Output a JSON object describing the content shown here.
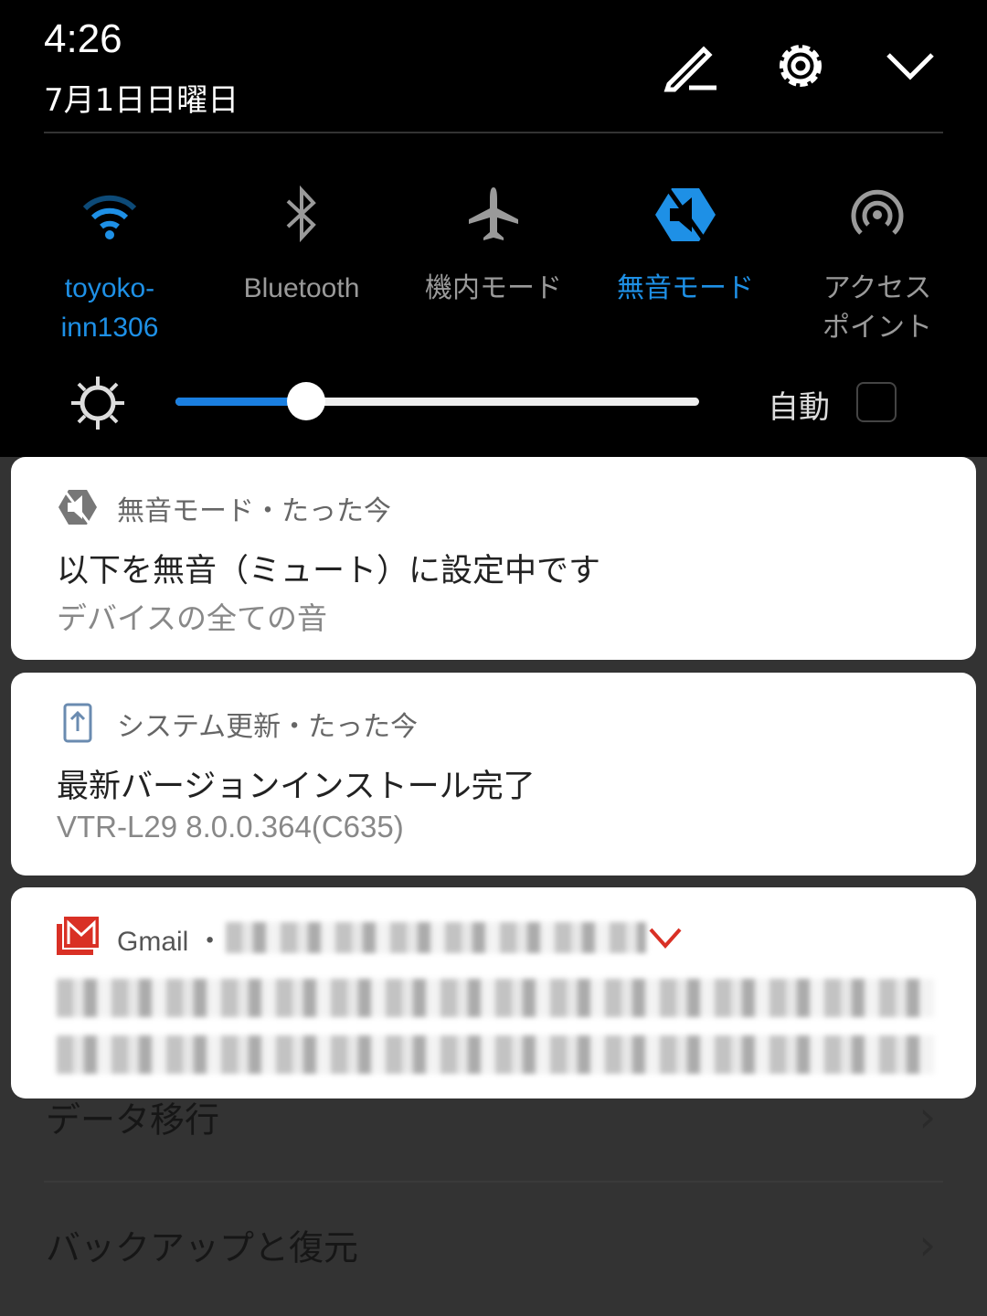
{
  "status": {
    "time": "4:26",
    "date": "7月1日日曜日"
  },
  "header_icons": [
    "edit-icon",
    "settings-icon",
    "collapse-chevron-icon"
  ],
  "tiles": [
    {
      "label": "toyoko-\ninn1306",
      "icon": "wifi-icon",
      "active": true
    },
    {
      "label": "Bluetooth",
      "icon": "bluetooth-icon",
      "active": false
    },
    {
      "label": "機内モード",
      "icon": "airplane-icon",
      "active": false
    },
    {
      "label": "無音モード",
      "icon": "silent-mode-icon",
      "active": true
    },
    {
      "label": "アクセス\nポイント",
      "icon": "hotspot-icon",
      "active": false
    }
  ],
  "brightness": {
    "level": 0.25,
    "auto_label": "自動",
    "auto_checked": false
  },
  "accent": "#1e90e6",
  "notifications": [
    {
      "app": "無音モード・たった今",
      "title": "以下を無音（ミュート）に設定中です",
      "body": "デバイスの全ての音",
      "icon": "silent-mode-icon"
    },
    {
      "app": "システム更新・たった今",
      "title": "最新バージョンインストール完了",
      "body": "VTR-L29 8.0.0.364(C635)",
      "icon": "system-update-icon"
    },
    {
      "app": "Gmail ・",
      "icon": "gmail-icon",
      "brand_color": "#d93025"
    }
  ],
  "settings_rows": [
    {
      "label": "データ移行"
    },
    {
      "label": "バックアップと復元"
    }
  ]
}
